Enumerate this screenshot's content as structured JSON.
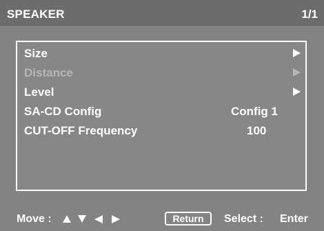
{
  "header": {
    "title": "SPEAKER",
    "page": "1/1"
  },
  "menu": {
    "items": [
      {
        "label": "Size",
        "enabled": true,
        "arrow": "right-arrow-icon"
      },
      {
        "label": "Distance",
        "enabled": false,
        "arrow": "right-arrow-icon"
      },
      {
        "label": "Level",
        "enabled": true,
        "arrow": "right-arrow-icon"
      },
      {
        "label": "SA-CD Config",
        "enabled": true,
        "value": "Config 1"
      },
      {
        "label": "CUT-OFF Frequency",
        "enabled": true,
        "value": "100"
      }
    ]
  },
  "footer": {
    "move_label": "Move :",
    "move_icons": [
      "up-arrow-icon",
      "down-arrow-icon",
      "left-arrow-icon",
      "right-arrow-icon"
    ],
    "return_label": "Return",
    "select_label": "Select :",
    "enter_label": "Enter"
  },
  "colors": {
    "background": "#838383",
    "title_bar": "#6c6c6c",
    "text": "#ffffff",
    "disabled_text": "#b6b6b6"
  }
}
